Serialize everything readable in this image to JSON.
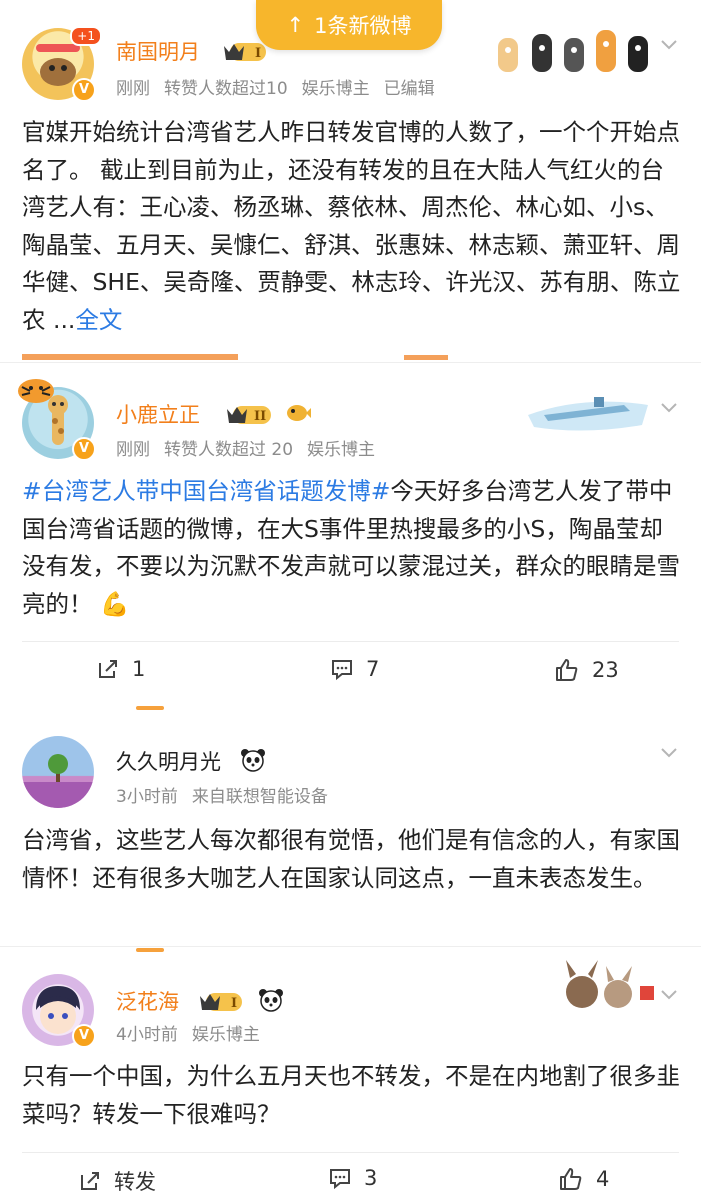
{
  "toast": {
    "arrow": "↑",
    "label": "1条新微博"
  },
  "post1": {
    "author": "南国明月",
    "badge_count": "+1",
    "time": "刚刚",
    "reposts": "转赞人数超过10",
    "tag": "娱乐博主",
    "edited": "已编辑",
    "text": "官媒开始统计台湾省艺人昨日转发官博的人数了，一个个开始点名了。 截止到目前为止，还没有转发的且在大陆人气红火的台湾艺人有：王心凌、杨丞琳、蔡依林、周杰伦、林心如、小s、陶晶莹、五月天、吴慷仁、舒淇、张惠妹、林志颖、萧亚轩、周华健、SHE、吴奇隆、贾静雯、林志玲、许光汉、苏有朋、陈立农 ...",
    "more": "全文"
  },
  "post2": {
    "author": "小鹿立正",
    "time": "刚刚",
    "reposts": "转赞人数超过 20",
    "tag": "娱乐博主",
    "topic": "#台湾艺人带中国台湾省话题发博#",
    "text": "今天好多台湾艺人发了带中国台湾省话题的微博，在大S事件里热搜最多的小S，陶晶莹却没有发，不要以为沉默不发声就可以蒙混过关，群众的眼睛是雪亮的！",
    "emoji": "💪",
    "repost_count": "1",
    "comment_count": "7",
    "like_count": "23"
  },
  "comment1": {
    "author": "久久明月光",
    "time": "3小时前",
    "source": "来自联想智能设备",
    "text": "台湾省，这些艺人每次都很有觉悟，他们是有信念的人，有家国情怀！还有很多大咖艺人在国家认同这点，一直未表态发生。"
  },
  "post3": {
    "author": "泛花海",
    "time": "4小时前",
    "tag": "娱乐博主",
    "text": "只有一个中国，为什么五月天也不转发，不是在内地割了很多韭菜吗？转发一下很难吗？",
    "repost_label": "转发",
    "comment_count": "3",
    "like_count": "4"
  },
  "colors": {
    "accent": "#f27f1b",
    "link": "#2c7be3",
    "toast": "#f7b62c"
  }
}
